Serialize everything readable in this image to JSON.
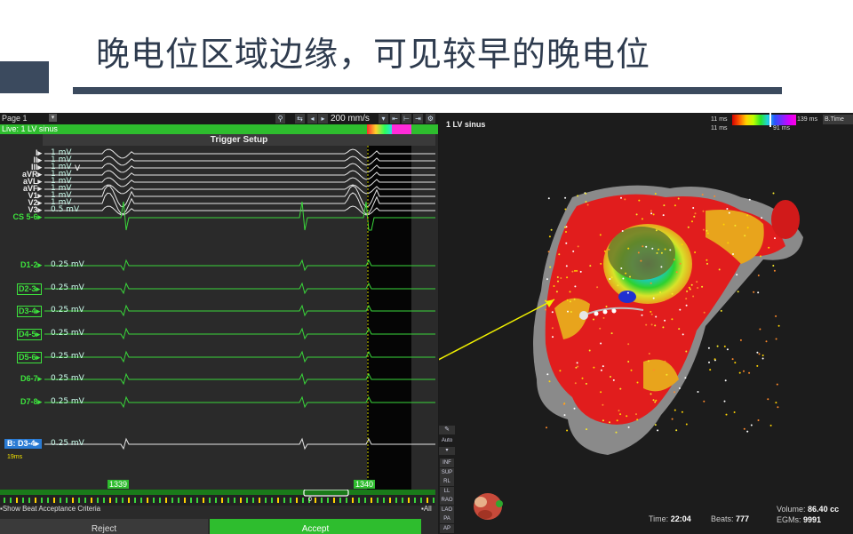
{
  "slide": {
    "title": "晚电位区域边缘，可见较早的晚电位"
  },
  "left_panel": {
    "page": "Page 1",
    "live": "Live: 1 LV sinus",
    "sweep_speed": "200 mm/s",
    "trigger_setup": "Trigger Setup",
    "channels": [
      {
        "label": "I",
        "gain": "1 mV"
      },
      {
        "label": "II",
        "gain": "1 mV"
      },
      {
        "label": "III",
        "gain": "1 mV"
      },
      {
        "label": "aVR",
        "gain": "1 mV"
      },
      {
        "label": "aVL",
        "gain": "1 mV"
      },
      {
        "label": "aVF",
        "gain": "1 mV"
      },
      {
        "label": "V1",
        "gain": "1 mV"
      },
      {
        "label": "V2",
        "gain": "1 mV"
      },
      {
        "label": "V3",
        "gain": "0.5 mV"
      },
      {
        "label": "CS 5-6",
        "gain": ""
      },
      {
        "label": "D1-2",
        "gain": "0.25 mV"
      },
      {
        "label": "D2-3",
        "gain": "0.25 mV"
      },
      {
        "label": "D3-4",
        "gain": "0.25 mV"
      },
      {
        "label": "D4-5",
        "gain": "0.25 mV"
      },
      {
        "label": "D5-6",
        "gain": "0.25 mV"
      },
      {
        "label": "D6-7",
        "gain": "0.25 mV"
      },
      {
        "label": "D7-8",
        "gain": "0.25 mV"
      },
      {
        "label": "B: D3-4",
        "gain": "0.25 mV"
      }
    ],
    "v_marker": "V",
    "roving_ms": "19ms",
    "timeline_left": "1339",
    "timeline_right": "1340",
    "timeline_zero": "0",
    "show_beat": "Show Beat Acceptance Criteria",
    "all": "All",
    "reject": "Reject",
    "accept": "Accept"
  },
  "right_panel": {
    "map_title": "1 LV sinus",
    "color_low_top": "11 ms",
    "color_low_bottom": "11 ms",
    "color_high_top": "139 ms",
    "color_high_bottom": "91 ms",
    "map_mode": "B.Time",
    "auto": "Auto",
    "views": [
      "INF",
      "SUP",
      "RL",
      "LL",
      "RAO",
      "LAO",
      "PA",
      "AP"
    ],
    "time_label": "Time:",
    "time_value": "22:04",
    "beats_label": "Beats:",
    "beats_value": "777",
    "volume_label": "Volume:",
    "volume_value": "86.40 cc",
    "egms_label": "EGMs:",
    "egms_value": "9991"
  },
  "colors": {
    "accent_green": "#2ebd2e",
    "title_navy": "#2e3b4e",
    "annotation_arrow": "#f0f000"
  }
}
